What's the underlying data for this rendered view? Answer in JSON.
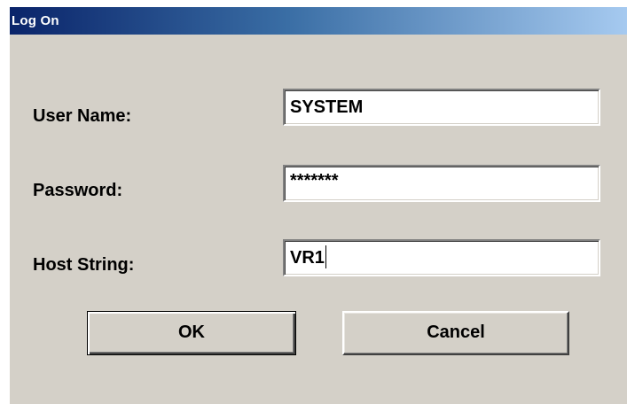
{
  "window": {
    "title": "Log On"
  },
  "form": {
    "user_name_label": "User Name:",
    "user_name_value": "SYSTEM",
    "password_label": "Password:",
    "password_value": "*******",
    "host_string_label": "Host String:",
    "host_string_value": "VR1"
  },
  "buttons": {
    "ok_label": "OK",
    "cancel_label": "Cancel"
  },
  "colors": {
    "dialog_background": "#d4d0c8",
    "titlebar_start": "#0a246a",
    "titlebar_end": "#a6caf0",
    "title_text": "#ffffff"
  }
}
